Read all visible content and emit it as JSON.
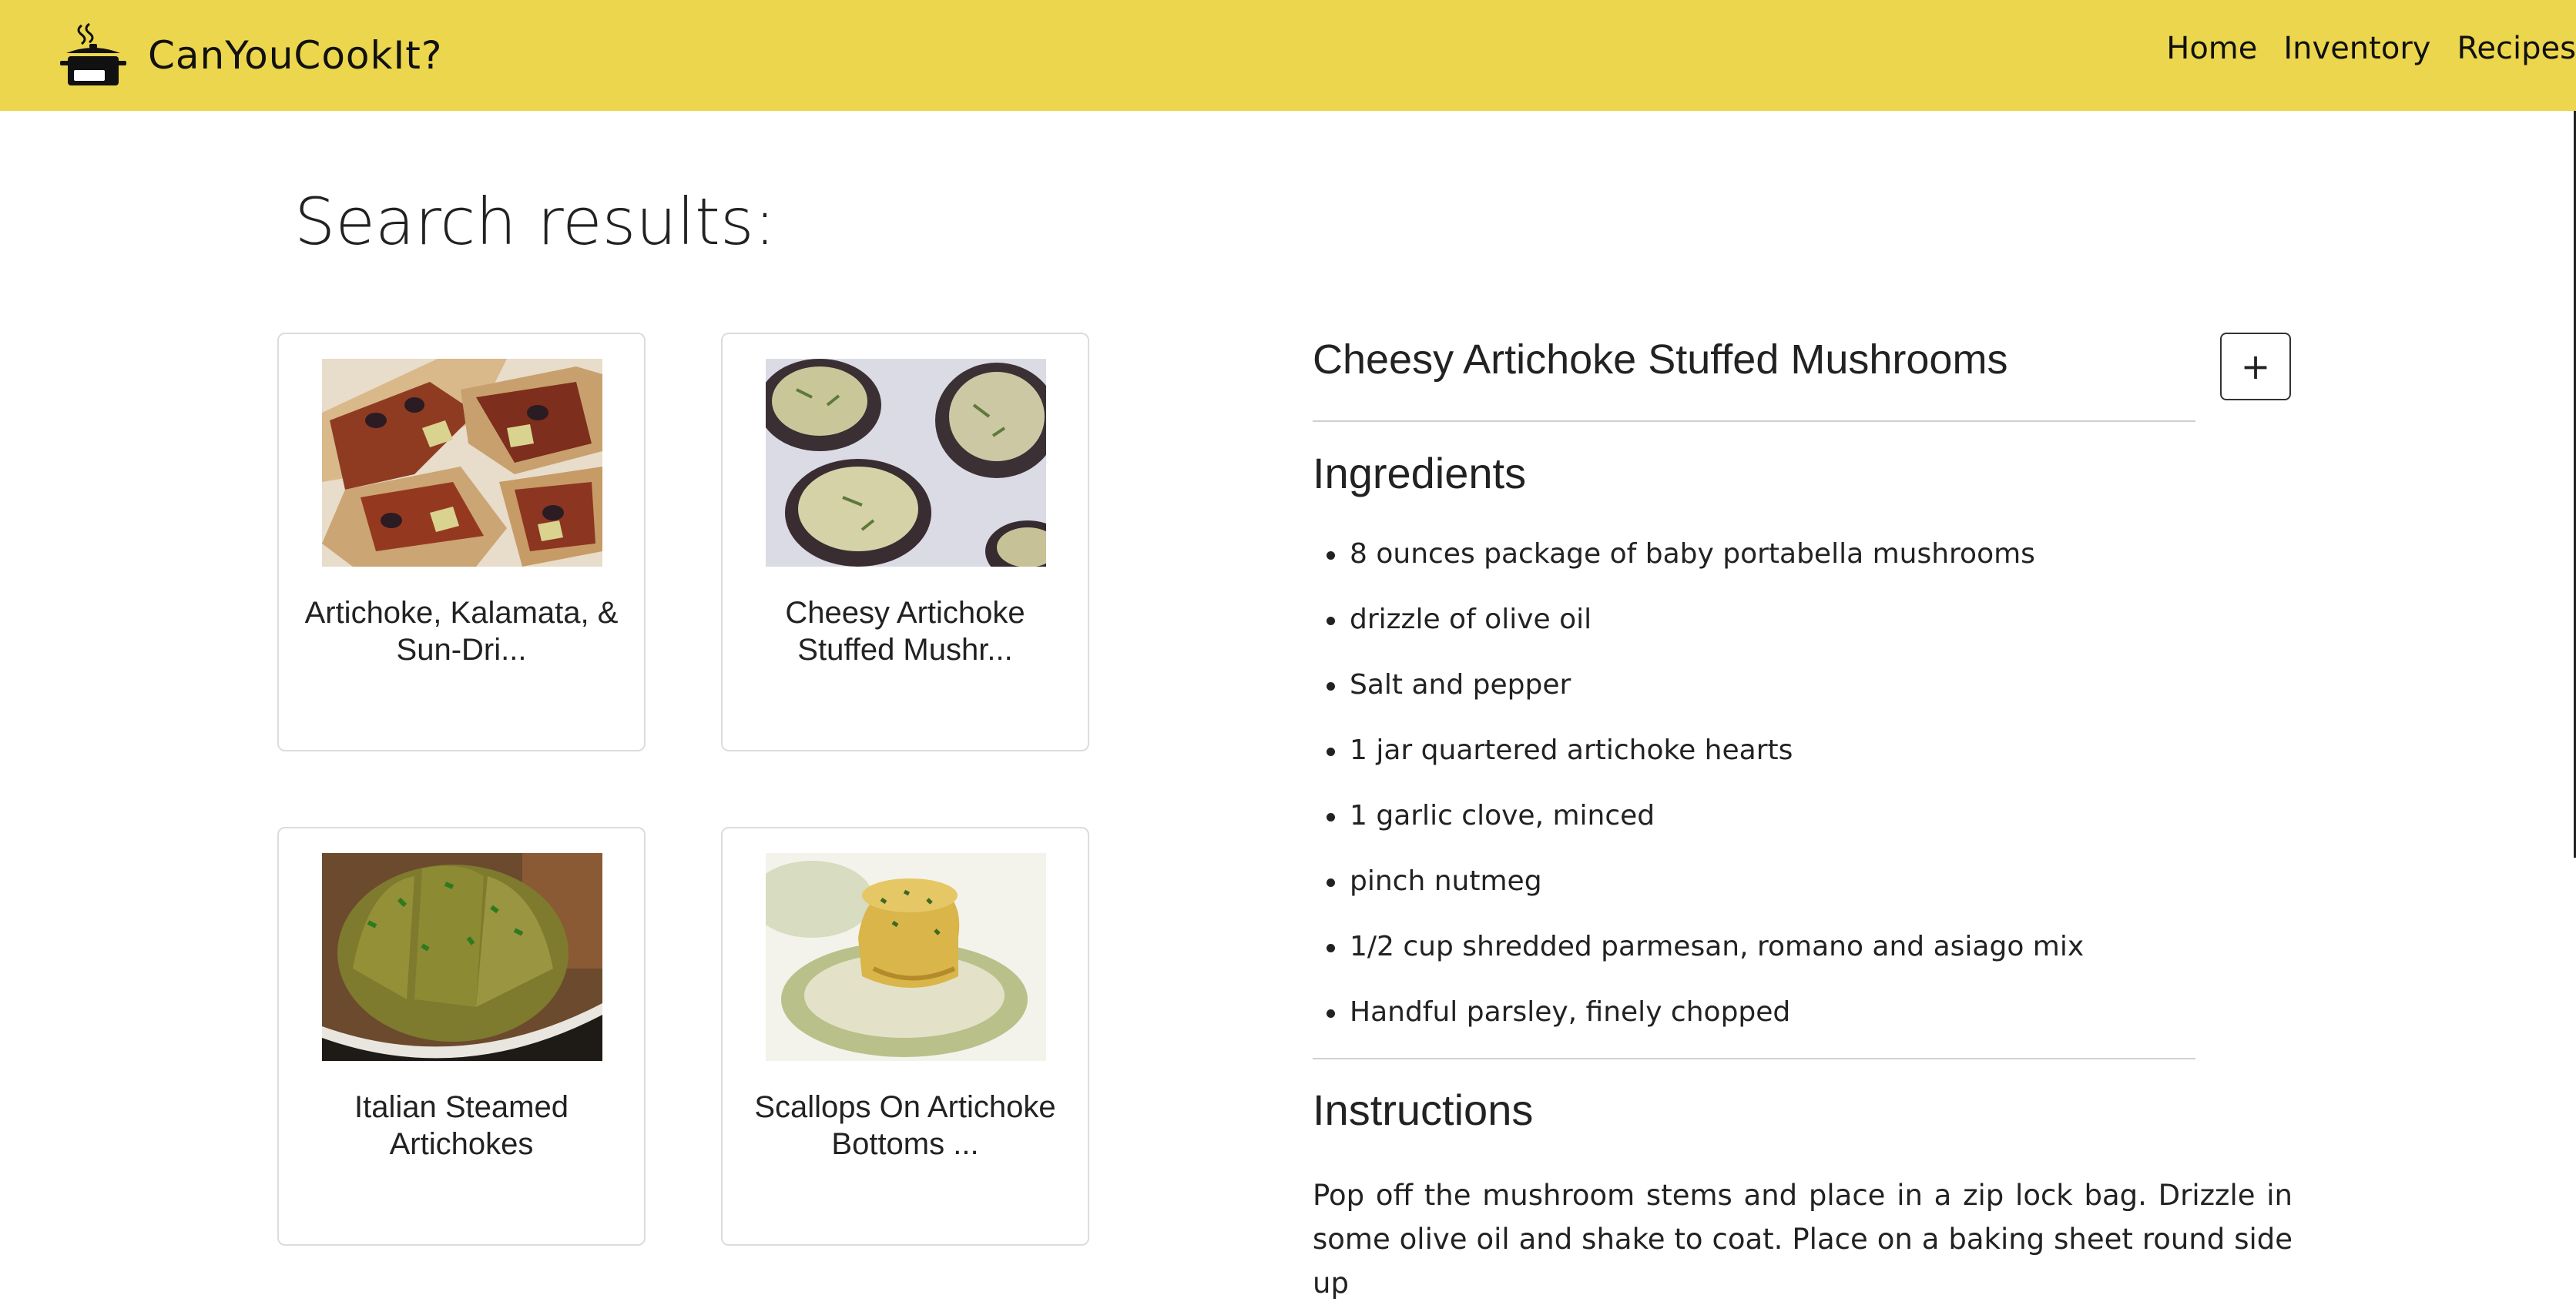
{
  "header": {
    "app_name": "CanYouCookIt?",
    "logo_icon": "cooking-pot-icon",
    "background_color": "#ebd64d",
    "nav": [
      {
        "label": "Home"
      },
      {
        "label": "Inventory"
      },
      {
        "label": "Recipes"
      }
    ]
  },
  "main": {
    "title": "Search results:",
    "results": [
      {
        "title": "Artichoke, Kalamata, & Sun-Dri...",
        "image": "bruschetta-photo"
      },
      {
        "title": "Cheesy Artichoke Stuffed Mushr...",
        "image": "stuffed-mushrooms-photo"
      },
      {
        "title": "Italian Steamed Artichokes",
        "image": "steamed-artichoke-photo"
      },
      {
        "title": "Scallops On Artichoke Bottoms ...",
        "image": "scallop-photo"
      }
    ]
  },
  "detail": {
    "title": "Cheesy Artichoke Stuffed Mushrooms",
    "add_button": "+",
    "ingredients_heading": "Ingredients",
    "ingredients": [
      "8 ounces package of baby portabella mushrooms",
      "drizzle of olive oil",
      "Salt and pepper",
      "1 jar quartered artichoke hearts",
      "1 garlic clove, minced",
      "pinch nutmeg",
      "1/2 cup shredded parmesan, romano and asiago mix",
      "Handful parsley, finely chopped"
    ],
    "instructions_heading": "Instructions",
    "instructions_text": "Pop off the mushroom stems and place in a zip lock bag. Drizzle in some olive oil and shake to coat. Place on a baking sheet round side up"
  }
}
